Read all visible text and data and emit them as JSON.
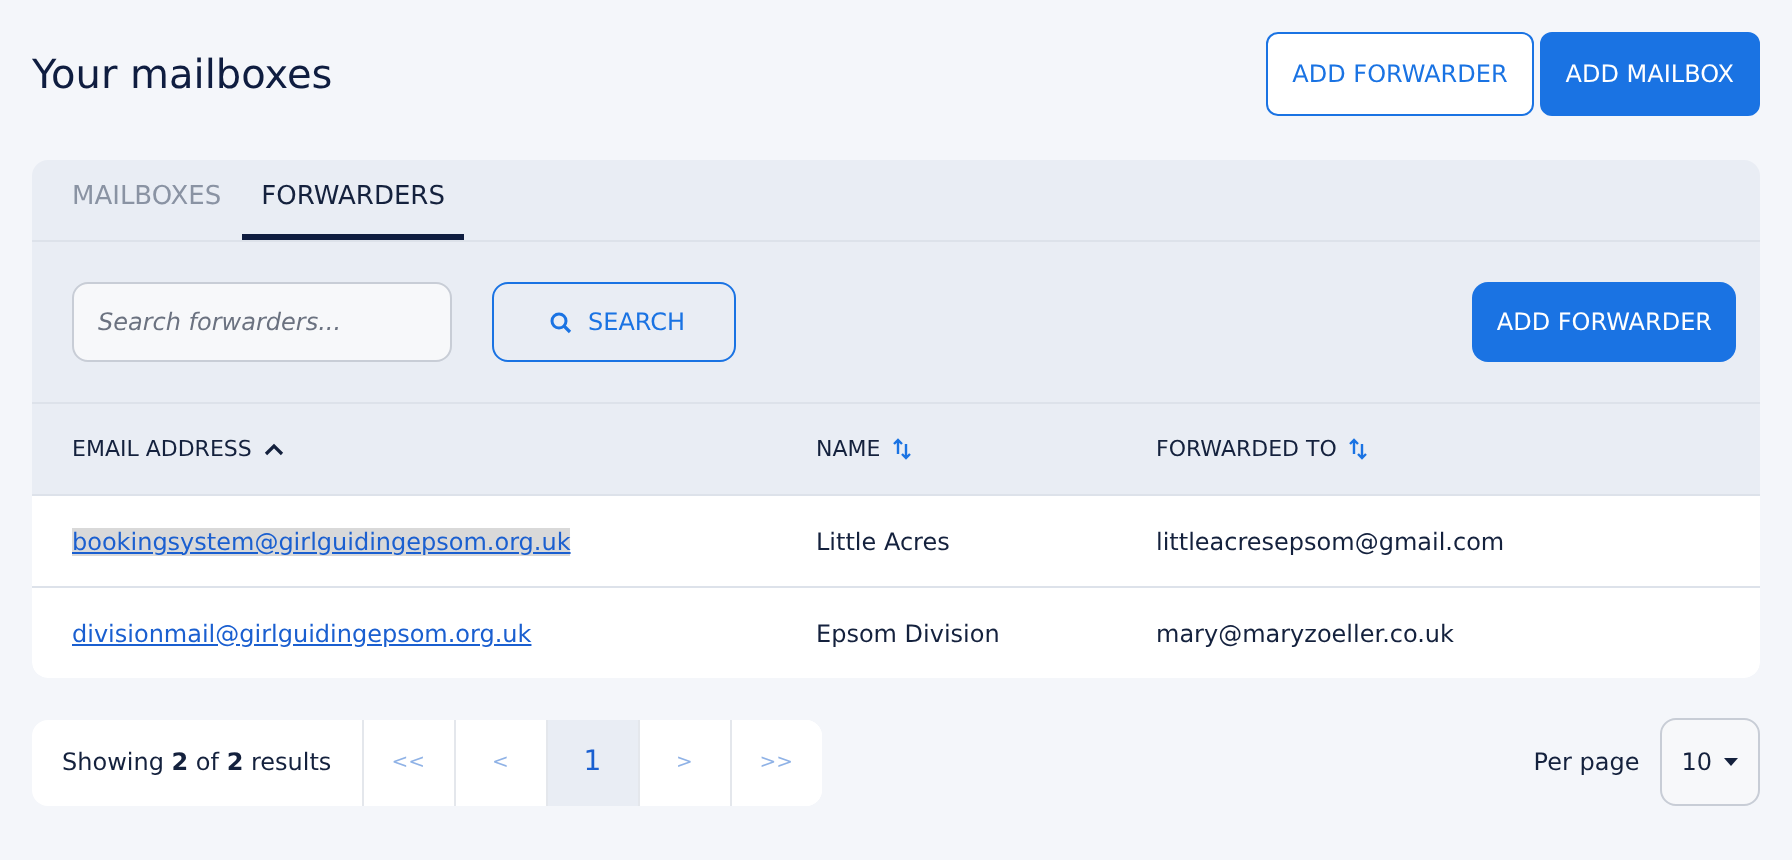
{
  "title": "Your mailboxes",
  "header_buttons": [
    {
      "label": "ADD FORWARDER",
      "kind": "outline"
    },
    {
      "label": "ADD MAILBOX",
      "kind": "solid"
    }
  ],
  "tabs": [
    {
      "label": "MAILBOXES",
      "selected": false
    },
    {
      "label": "FORWARDERS",
      "selected": true
    }
  ],
  "search": {
    "placeholder": "Search forwarders...",
    "button": "SEARCH"
  },
  "add_button": "ADD FORWARDER",
  "table": {
    "columns": [
      {
        "label": "EMAIL ADDRESS",
        "sorted": true
      },
      {
        "label": "NAME",
        "sorted": false
      },
      {
        "label": "FORWARDED TO",
        "sorted": false
      }
    ],
    "rows": [
      {
        "email": "bookingsystem@girlguidingepsom.org.uk",
        "name": "Little Acres",
        "forwarded_to": "littleacresepsom@gmail.com",
        "highlighted": true
      },
      {
        "email": "divisionmail@girlguidingepsom.org.uk",
        "name": "Epsom Division",
        "forwarded_to": "mary@maryzoeller.co.uk",
        "highlighted": false
      }
    ]
  },
  "pagination": {
    "summary": "Showing **2** of **2** results",
    "pages": [
      {
        "label": "<<",
        "selected": false
      },
      {
        "label": "<",
        "selected": false
      },
      {
        "label": "1",
        "selected": true
      },
      {
        "label": ">",
        "selected": false
      },
      {
        "label": ">>",
        "selected": false
      }
    ],
    "per_page_label": "Per page",
    "per_page": "10"
  }
}
